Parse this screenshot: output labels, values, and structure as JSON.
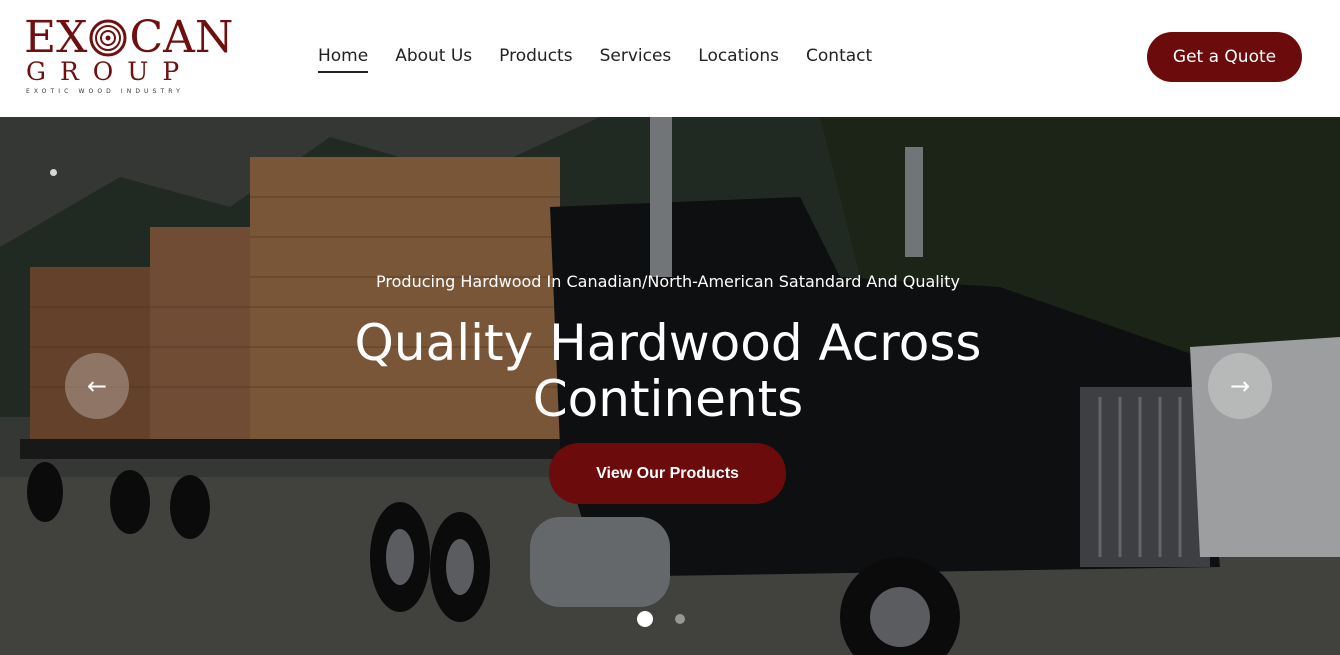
{
  "brand": {
    "logo_word_start": "EX",
    "logo_word_end": "CAN",
    "logo_word_2": "GROUP",
    "tagline": "EXOTIC WOOD INDUSTRY",
    "color": "#6f0f0f"
  },
  "nav": {
    "items": [
      {
        "label": "Home",
        "active": true
      },
      {
        "label": "About Us",
        "active": false
      },
      {
        "label": "Products",
        "active": false
      },
      {
        "label": "Services",
        "active": false
      },
      {
        "label": "Locations",
        "active": false
      },
      {
        "label": "Contact",
        "active": false
      }
    ],
    "cta_label": "Get a Quote"
  },
  "hero": {
    "subtitle": "Producing Hardwood In Canadian/North-American Satandard And Quality",
    "title": "Quality Hardwood Across Continents",
    "cta_label": "View Our Products",
    "prev_icon": "←",
    "next_icon": "→",
    "slides_total": 2,
    "active_slide": 1,
    "accent": "#6b0b0b"
  }
}
